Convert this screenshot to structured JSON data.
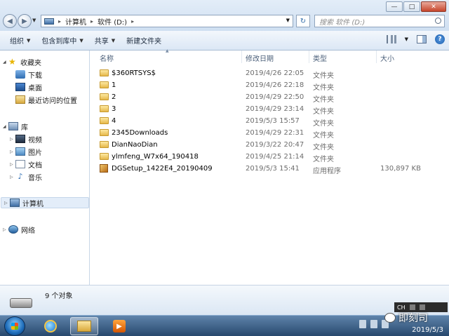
{
  "window": {
    "controls": {
      "minimize": "—",
      "maximize": "□",
      "close": "✕"
    }
  },
  "address": {
    "segments": [
      "计算机",
      "软件 (D:)"
    ],
    "separator": "▸",
    "refresh": "↻",
    "search_placeholder": "搜索 软件 (D:)"
  },
  "toolbar": {
    "organize": "组织",
    "include_in_library": "包含到库中",
    "share": "共享",
    "new_folder": "新建文件夹",
    "help": "?"
  },
  "nav": {
    "favorites": "收藏夹",
    "downloads": "下载",
    "desktop": "桌面",
    "recent": "最近访问的位置",
    "libraries": "库",
    "videos": "视频",
    "pictures": "图片",
    "documents": "文档",
    "music": "音乐",
    "computer": "计算机",
    "network": "网络"
  },
  "columns": {
    "name": "名称",
    "date": "修改日期",
    "type": "类型",
    "size": "大小"
  },
  "files": [
    {
      "name": "$360RTSYS$",
      "date": "2019/4/26 22:05",
      "type": "文件夹",
      "size": "",
      "icon": "folder-icon"
    },
    {
      "name": "1",
      "date": "2019/4/26 22:18",
      "type": "文件夹",
      "size": "",
      "icon": "folder-icon"
    },
    {
      "name": "2",
      "date": "2019/4/29 22:50",
      "type": "文件夹",
      "size": "",
      "icon": "folder-icon"
    },
    {
      "name": "3",
      "date": "2019/4/29 23:14",
      "type": "文件夹",
      "size": "",
      "icon": "folder-icon"
    },
    {
      "name": "4",
      "date": "2019/5/3 15:57",
      "type": "文件夹",
      "size": "",
      "icon": "folder-icon"
    },
    {
      "name": "2345Downloads",
      "date": "2019/4/29 22:31",
      "type": "文件夹",
      "size": "",
      "icon": "folder-icon"
    },
    {
      "name": "DianNaoDian",
      "date": "2019/3/22 20:47",
      "type": "文件夹",
      "size": "",
      "icon": "folder-icon"
    },
    {
      "name": "ylmfeng_W7x64_190418",
      "date": "2019/4/25 21:14",
      "type": "文件夹",
      "size": "",
      "icon": "folder-icon"
    },
    {
      "name": "DGSetup_1422E4_20190409",
      "date": "2019/5/3 15:41",
      "type": "应用程序",
      "size": "130,897 KB",
      "icon": "application-icon"
    }
  ],
  "details": {
    "count": "9 个对象"
  },
  "taskbar": {
    "lang": "CH",
    "clock": "2019/5/3",
    "watermark": "即刻司"
  }
}
